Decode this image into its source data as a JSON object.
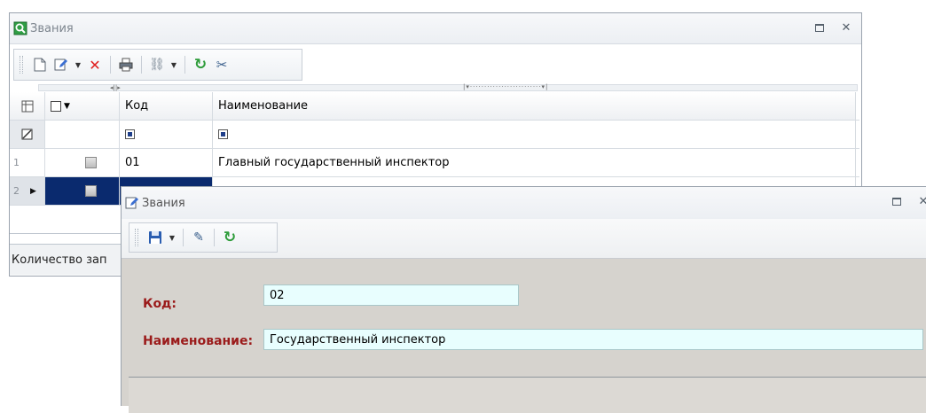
{
  "back_window": {
    "title": "Звания",
    "grid": {
      "headers": {
        "code": "Код",
        "name": "Наименование"
      },
      "rows": [
        {
          "num": "1",
          "code": "01",
          "name": "Главный государственный инспектор"
        },
        {
          "num": "2",
          "code": "",
          "name": ""
        }
      ]
    },
    "status": "Количество зап"
  },
  "front_window": {
    "title": "Звания",
    "fields": {
      "code_label": "Код:",
      "code_value": "02",
      "name_label": "Наименование:",
      "name_value": "Государственный инспектор"
    }
  }
}
